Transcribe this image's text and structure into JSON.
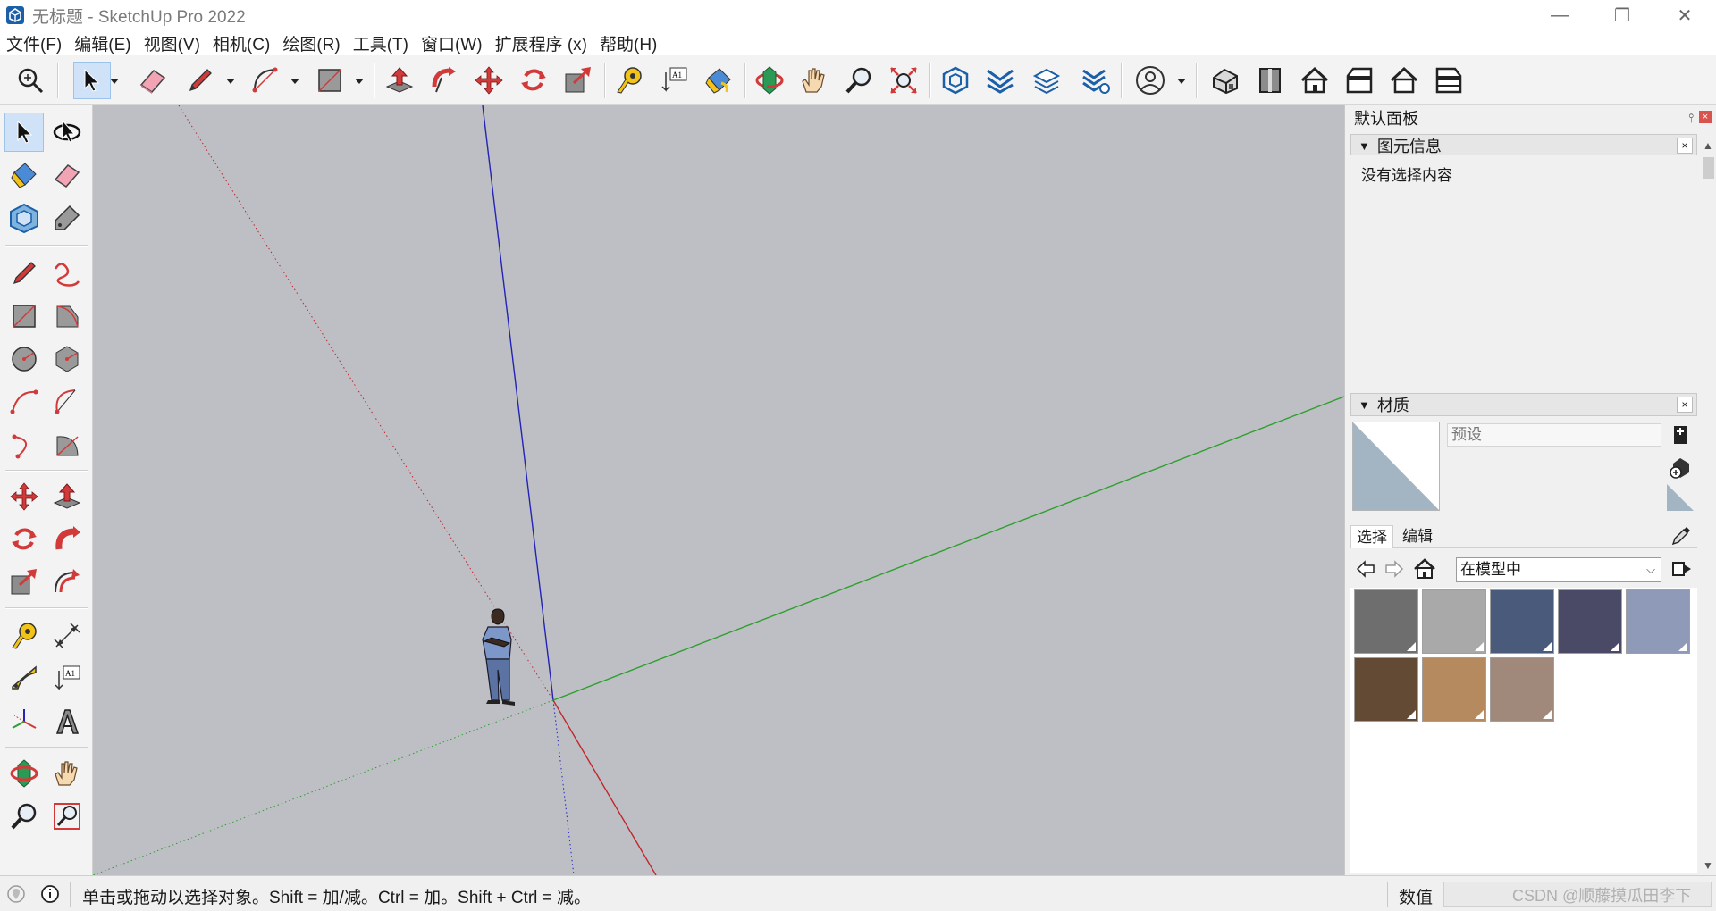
{
  "window": {
    "title": "无标题 - SketchUp Pro 2022",
    "app_icon": "sketchup-logo-icon",
    "controls": [
      "minimize-icon",
      "restore-icon",
      "close-icon"
    ],
    "minimize": "—",
    "restore": "❐",
    "close": "✕"
  },
  "menu": {
    "items": [
      {
        "label": "文件(F)"
      },
      {
        "label": "编辑(E)"
      },
      {
        "label": "视图(V)"
      },
      {
        "label": "相机(C)"
      },
      {
        "label": "绘图(R)"
      },
      {
        "label": "工具(T)"
      },
      {
        "label": "窗口(W)"
      },
      {
        "label": "扩展程序 (x)"
      },
      {
        "label": "帮助(H)"
      }
    ]
  },
  "toolbar": {
    "icons": [
      "search-icon",
      "select-icon",
      "eraser-icon",
      "pencil-icon",
      "arc-icon",
      "rectangle-icon",
      "push-pull-icon",
      "follow-me-icon",
      "move-icon",
      "rotate-icon",
      "scale-icon",
      "tape-measure-icon",
      "text-icon",
      "paint-bucket-icon",
      "orbit-icon",
      "pan-icon",
      "zoom-icon",
      "zoom-extents-icon",
      "warehouse-icon",
      "extension-warehouse-icon",
      "layout-icon",
      "extension-manager-icon",
      "account-icon",
      "iso-view-icon",
      "top-view-icon",
      "front-view-icon",
      "right-view-icon",
      "back-view-icon",
      "left-view-icon"
    ],
    "text_tool_label": "A1"
  },
  "left_toolbar": {
    "icons": [
      "select-icon",
      "orbit-select-icon",
      "paint-bucket-icon",
      "eraser-icon",
      "component-icon",
      "tag-icon",
      "pencil-icon",
      "freehand-icon",
      "rectangle-icon",
      "rotated-rectangle-icon",
      "circle-icon",
      "polygon-icon",
      "arc-icon",
      "two-point-arc-icon",
      "three-point-arc-icon",
      "pie-icon",
      "move-icon",
      "push-pull-icon",
      "rotate-icon",
      "follow-me-icon",
      "scale-icon",
      "offset-icon",
      "tape-measure-icon",
      "dimension-icon",
      "protractor-icon",
      "text-icon",
      "axes-icon",
      "3d-text-icon",
      "orbit-icon",
      "pan-icon",
      "zoom-icon",
      "zoom-window-icon"
    ],
    "text_tool_label": "A1"
  },
  "panel": {
    "title": "默认面板",
    "pin": "⫯",
    "close": "×",
    "entity_info": {
      "title": "图元信息",
      "close": "×",
      "empty_text": "没有选择内容"
    },
    "materials": {
      "title": "材质",
      "close": "×",
      "name_placeholder": "预设",
      "tabs": [
        "选择",
        "编辑"
      ],
      "dropdown_value": "在模型中",
      "dropdown_arrow": "⌵",
      "preview_color": "#a3b5c3",
      "swatches": [
        {
          "color": "#6e6e6e"
        },
        {
          "color": "#a9a9a9"
        },
        {
          "color": "#4a5a7a"
        },
        {
          "color": "#4a4a66"
        },
        {
          "color": "#8e9ab8"
        },
        {
          "color": "#634a34"
        },
        {
          "color": "#b48a5e"
        },
        {
          "color": "#a0887a"
        }
      ]
    }
  },
  "status": {
    "message": "单击或拖动以选择对象。Shift = 加/减。Ctrl = 加。Shift + Ctrl = 减。",
    "measure_label": "数值",
    "watermark": "CSDN @顺藤摸瓜田李下"
  },
  "colors": {
    "viewport_bg": "#bebfc4",
    "axis_red": "#c0272d",
    "axis_green": "#2ea02e",
    "axis_blue": "#2323b5"
  }
}
